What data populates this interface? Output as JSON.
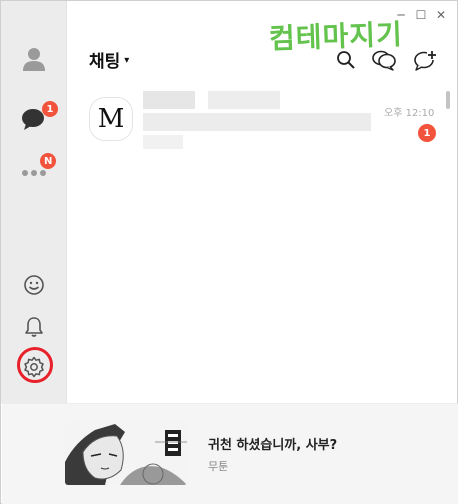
{
  "window": {
    "minimize_symbol": "─",
    "maximize_symbol": "☐",
    "close_symbol": "✕"
  },
  "watermark": "컴테마지기",
  "sidebar": {
    "items": [
      {
        "icon": "person-icon"
      },
      {
        "icon": "chat-bubble-icon",
        "badge": "1"
      },
      {
        "icon": "more-dots-icon",
        "badge": "N"
      },
      {
        "icon": "emoticon-icon"
      },
      {
        "icon": "bell-icon"
      },
      {
        "icon": "gear-icon"
      }
    ]
  },
  "header": {
    "title": "채팅",
    "caret": "▾",
    "icons": [
      "search-icon",
      "open-chat-icon",
      "new-chat-icon"
    ]
  },
  "chats": [
    {
      "avatar_letter": "M",
      "time": "오후 12:10",
      "unread": "1"
    }
  ],
  "banner": {
    "title": "귀천 하셨습니까, 사부?",
    "subtitle": "무툰"
  },
  "colors": {
    "badge": "#f2533d",
    "highlight_ring": "#e8202a",
    "watermark": "#63c34d",
    "sidebar_bg": "#ececec"
  }
}
